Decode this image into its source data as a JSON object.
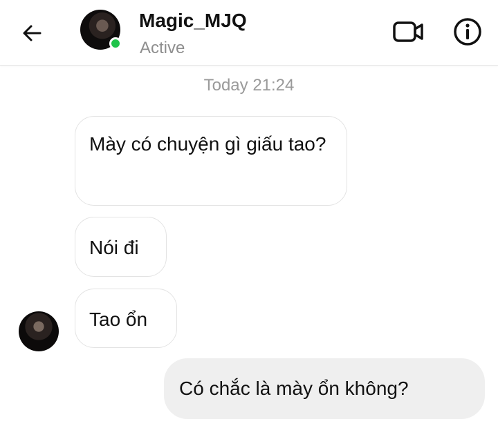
{
  "header": {
    "contact_name": "Magic_MJQ",
    "status": "Active",
    "status_color": "#1fc44a",
    "icons": {
      "back": "back-arrow-icon",
      "video": "video-call-icon",
      "info": "info-icon"
    }
  },
  "conversation": {
    "timestamp": "Today 21:24",
    "messages": [
      {
        "direction": "received",
        "text": "Mày có chuyện gì giấu tao?"
      },
      {
        "direction": "received",
        "text": "Nói đi"
      },
      {
        "direction": "received",
        "text": "Tao ổn"
      },
      {
        "direction": "sent",
        "text": "Có chắc là mày ổn không?"
      }
    ]
  }
}
